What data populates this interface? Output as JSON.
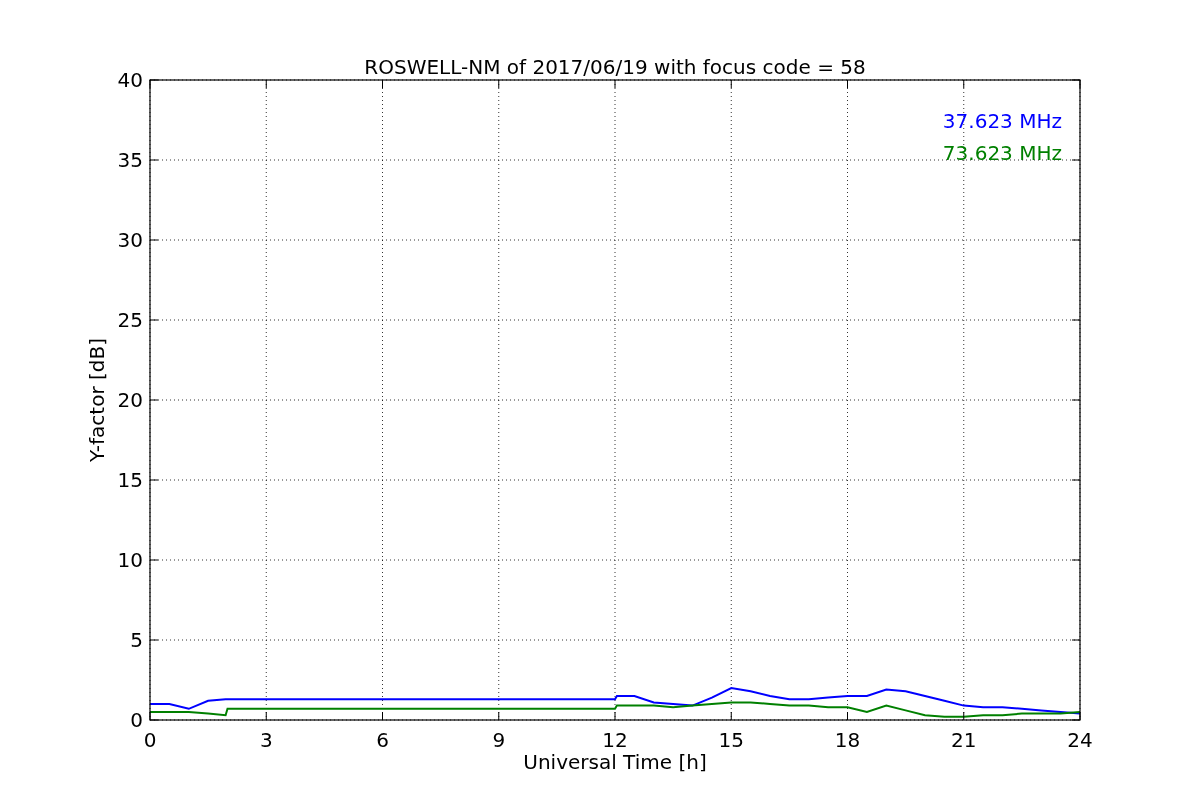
{
  "figure": {
    "chart_data": {
      "type": "line",
      "title": "ROSWELL-NM of 2017/06/19 with focus code = 58",
      "xlabel": "Universal Time [h]",
      "ylabel": "Y-factor [dB]",
      "x": [
        0,
        0.5,
        1,
        1.5,
        1.95,
        2,
        12,
        12.05,
        12.5,
        13,
        13.5,
        14,
        14.5,
        15,
        15.5,
        16,
        16.5,
        17,
        17.5,
        18,
        18.5,
        19,
        19.5,
        20,
        20.5,
        21,
        21.5,
        22,
        22.5,
        23,
        23.5,
        24
      ],
      "series": [
        {
          "name": "37.623 MHz",
          "color": "#0000ff",
          "values": [
            1.0,
            1.0,
            0.7,
            1.2,
            1.3,
            1.3,
            1.3,
            1.5,
            1.5,
            1.1,
            1.0,
            0.9,
            1.4,
            2.0,
            1.8,
            1.5,
            1.3,
            1.3,
            1.4,
            1.5,
            1.5,
            1.9,
            1.8,
            1.5,
            1.2,
            0.9,
            0.8,
            0.8,
            0.7,
            0.6,
            0.5,
            0.4
          ]
        },
        {
          "name": "73.623 MHz",
          "color": "#008000",
          "values": [
            0.5,
            0.5,
            0.5,
            0.4,
            0.3,
            0.7,
            0.7,
            0.9,
            0.9,
            0.9,
            0.8,
            0.9,
            1.0,
            1.1,
            1.1,
            1.0,
            0.9,
            0.9,
            0.8,
            0.8,
            0.5,
            0.9,
            0.6,
            0.3,
            0.2,
            0.2,
            0.3,
            0.3,
            0.4,
            0.4,
            0.4,
            0.5
          ]
        }
      ],
      "xlim": [
        0,
        24
      ],
      "ylim": [
        0,
        40
      ],
      "xticks": [
        0,
        3,
        6,
        9,
        12,
        15,
        18,
        21,
        24
      ],
      "yticks": [
        0,
        5,
        10,
        15,
        20,
        25,
        30,
        35,
        40
      ],
      "grid": true
    }
  }
}
